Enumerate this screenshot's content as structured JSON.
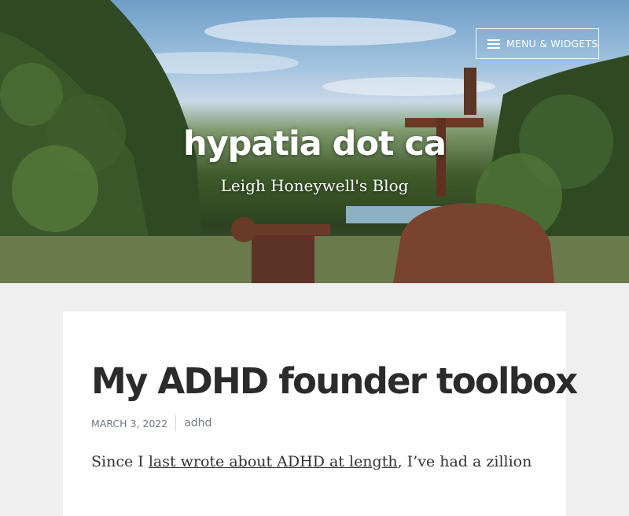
{
  "header": {
    "site_title": "hypatia dot ca",
    "site_description": "Leigh Honeywell's Blog",
    "menu_label": "MENU & WIDGETS"
  },
  "post": {
    "title": "My ADHD founder toolbox",
    "date": "MARCH 3, 2022",
    "category": "adhd",
    "excerpt_before": "Since I ",
    "excerpt_link": "last wrote about ADHD at length",
    "excerpt_after": ", I’ve had a zillion"
  }
}
